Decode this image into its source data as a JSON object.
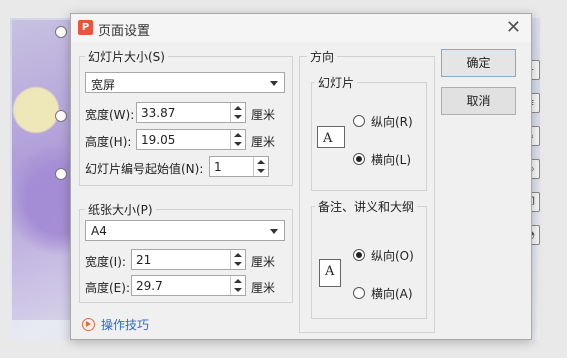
{
  "dialog": {
    "title": "页面设置",
    "app_icon": "P"
  },
  "slide_size": {
    "group_label": "幻灯片大小(S)",
    "preset": "宽屏",
    "width_label": "宽度(W):",
    "width_value": "33.87",
    "height_label": "高度(H):",
    "height_value": "19.05",
    "unit": "厘米",
    "start_label": "幻灯片编号起始值(N):",
    "start_value": "1"
  },
  "paper_size": {
    "group_label": "纸张大小(P)",
    "preset": "A4",
    "width_label": "宽度(I):",
    "width_value": "21",
    "height_label": "高度(E):",
    "height_value": "29.7",
    "unit": "厘米"
  },
  "orientation": {
    "group_label": "方向",
    "slides": {
      "label": "幻灯片",
      "portrait": "纵向(R)",
      "landscape": "横向(L)",
      "selected": "landscape"
    },
    "notes": {
      "label": "备注、讲义和大纲",
      "portrait": "纵向(O)",
      "landscape": "横向(A)",
      "selected": "portrait"
    },
    "page_glyph": "A"
  },
  "buttons": {
    "ok": "确定",
    "cancel": "取消"
  },
  "help": {
    "label": "操作技巧"
  }
}
